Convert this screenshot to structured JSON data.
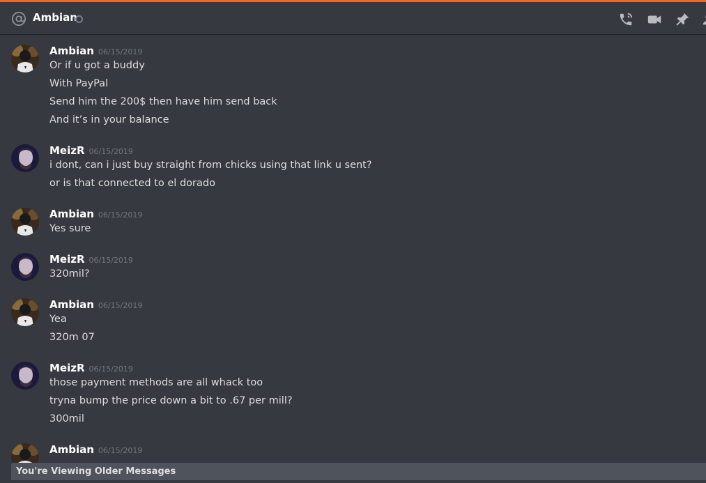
{
  "header": {
    "title": "Ambian",
    "icons": [
      "at-icon",
      "voice-call-icon",
      "video-call-icon",
      "pin-icon",
      "add-friend-icon"
    ]
  },
  "messages": [
    {
      "author": "Ambian",
      "timestamp": "06/15/2019",
      "avatar": "ambian-avatar",
      "lines": [
        "Or if u got a buddy",
        "With PayPal",
        "Send him the 200$ then have him send back",
        "And it’s in your balance"
      ]
    },
    {
      "author": "MeizR",
      "timestamp": "06/15/2019",
      "avatar": "meizr-avatar",
      "lines": [
        "i dont, can i just buy straight from chicks using that link u sent?",
        "or is that connected to el dorado"
      ]
    },
    {
      "author": "Ambian",
      "timestamp": "06/15/2019",
      "avatar": "ambian-avatar",
      "lines": [
        "Yes sure"
      ]
    },
    {
      "author": "MeizR",
      "timestamp": "06/15/2019",
      "avatar": "meizr-avatar",
      "lines": [
        "320mil?"
      ]
    },
    {
      "author": "Ambian",
      "timestamp": "06/15/2019",
      "avatar": "ambian-avatar",
      "lines": [
        "Yea",
        "320m 07"
      ]
    },
    {
      "author": "MeizR",
      "timestamp": "06/15/2019",
      "avatar": "meizr-avatar",
      "lines": [
        "those payment methods are all whack too",
        "tryna bump the price down a bit to .67 per mill?",
        "300mil"
      ]
    },
    {
      "author": "Ambian",
      "timestamp": "06/15/2019",
      "avatar": "ambian-avatar",
      "lines": []
    }
  ],
  "older_messages_bar": "You're Viewing Older Messages",
  "colors": {
    "accent": "#f26522",
    "background": "#36393f",
    "text": "#dcddde",
    "timestamp": "#72767d"
  }
}
